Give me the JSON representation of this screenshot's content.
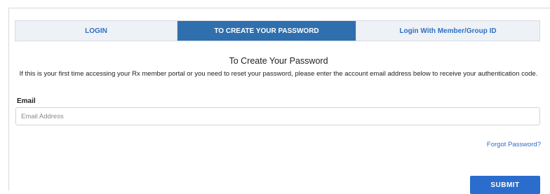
{
  "tabs": [
    {
      "label": "LOGIN",
      "active": false
    },
    {
      "label": "TO CREATE YOUR PASSWORD",
      "active": true
    },
    {
      "label": "Login With Member/Group ID",
      "active": false
    }
  ],
  "form": {
    "heading": "To Create Your Password",
    "description": "If this is your first time accessing your Rx member portal or you need to reset your password, please enter the account email address below to receive your authentication code.",
    "email_label": "Email",
    "email_placeholder": "Email Address",
    "email_value": "",
    "forgot_password": "Forgot Password?",
    "submit_label": "SUBMIT"
  },
  "colors": {
    "active_tab": "#2f6fae",
    "link": "#2f6fc2",
    "button": "#2a6dcc"
  }
}
